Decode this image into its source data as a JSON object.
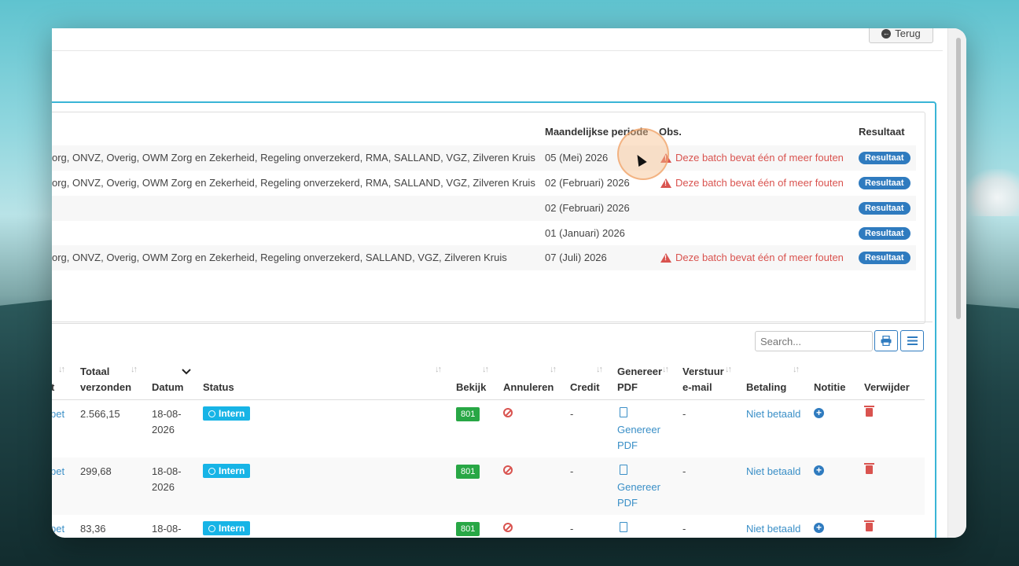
{
  "topbar": {
    "back_label": "Terug"
  },
  "batches": {
    "headers": {
      "period": "Maandelijkse periode",
      "obs": "Obs.",
      "result": "Resultaat"
    },
    "rows": [
      {
        "insurers": "org, ONVZ, Overig, OWM Zorg en Zekerheid, Regeling onverzekerd, RMA, SALLAND, VGZ, Zilveren Kruis",
        "period": "05 (Mei) 2026",
        "obs": "Deze batch bevat één of meer fouten",
        "result": "Resultaat"
      },
      {
        "insurers": "org, ONVZ, Overig, OWM Zorg en Zekerheid, Regeling onverzekerd, RMA, SALLAND, VGZ, Zilveren Kruis",
        "period": "02 (Februari) 2026",
        "obs": "Deze batch bevat één of meer fouten",
        "result": "Resultaat"
      },
      {
        "insurers": "",
        "period": "02 (Februari) 2026",
        "obs": "",
        "result": "Resultaat"
      },
      {
        "insurers": "",
        "period": "01 (Januari) 2026",
        "obs": "",
        "result": "Resultaat"
      },
      {
        "insurers": "org, ONVZ, Overig, OWM Zorg en Zekerheid, Regeling onverzekerd, SALLAND, VGZ, Zilveren Kruis",
        "period": "07 (Juli) 2026",
        "obs": "Deze batch bevat één of meer fouten",
        "result": "Resultaat"
      }
    ]
  },
  "search": {
    "placeholder": "Search..."
  },
  "invoices": {
    "headers": {
      "col0": "ort",
      "total_1": "Totaal",
      "total_2": "verzonden",
      "date": "Datum",
      "status": "Status",
      "view": "Bekijk",
      "cancel": "Annuleren",
      "credit": "Credit",
      "pdf_1": "Genereer",
      "pdf_2": "PDF",
      "email_1": "Verstuur",
      "email_2": "e-mail",
      "payment": "Betaling",
      "note": "Notitie",
      "delete": "Verwijder"
    },
    "rows": [
      {
        "col0": "pet",
        "total": "2.566,15",
        "date_1": "18-08-",
        "date_2": "2026",
        "status": "Intern",
        "view": "801",
        "credit": "-",
        "pdf_1": "Genereer",
        "pdf_2": "PDF",
        "email": "-",
        "payment": "Niet betaald"
      },
      {
        "col0": "pet",
        "total": "299,68",
        "date_1": "18-08-",
        "date_2": "2026",
        "status": "Intern",
        "view": "801",
        "credit": "-",
        "pdf_1": "Genereer",
        "pdf_2": "PDF",
        "email": "-",
        "payment": "Niet betaald"
      },
      {
        "col0": "pet",
        "total": "83,36",
        "date_1": "18-08-",
        "date_2": "",
        "status": "Intern",
        "view": "801",
        "credit": "-",
        "pdf_1": "",
        "pdf_2": "",
        "email": "-",
        "payment": "Niet betaald"
      }
    ]
  },
  "colors": {
    "accent": "#3ab5d6",
    "primary": "#2f7bbf",
    "danger": "#d9534f",
    "success": "#28a745",
    "info": "#17b4e6"
  }
}
